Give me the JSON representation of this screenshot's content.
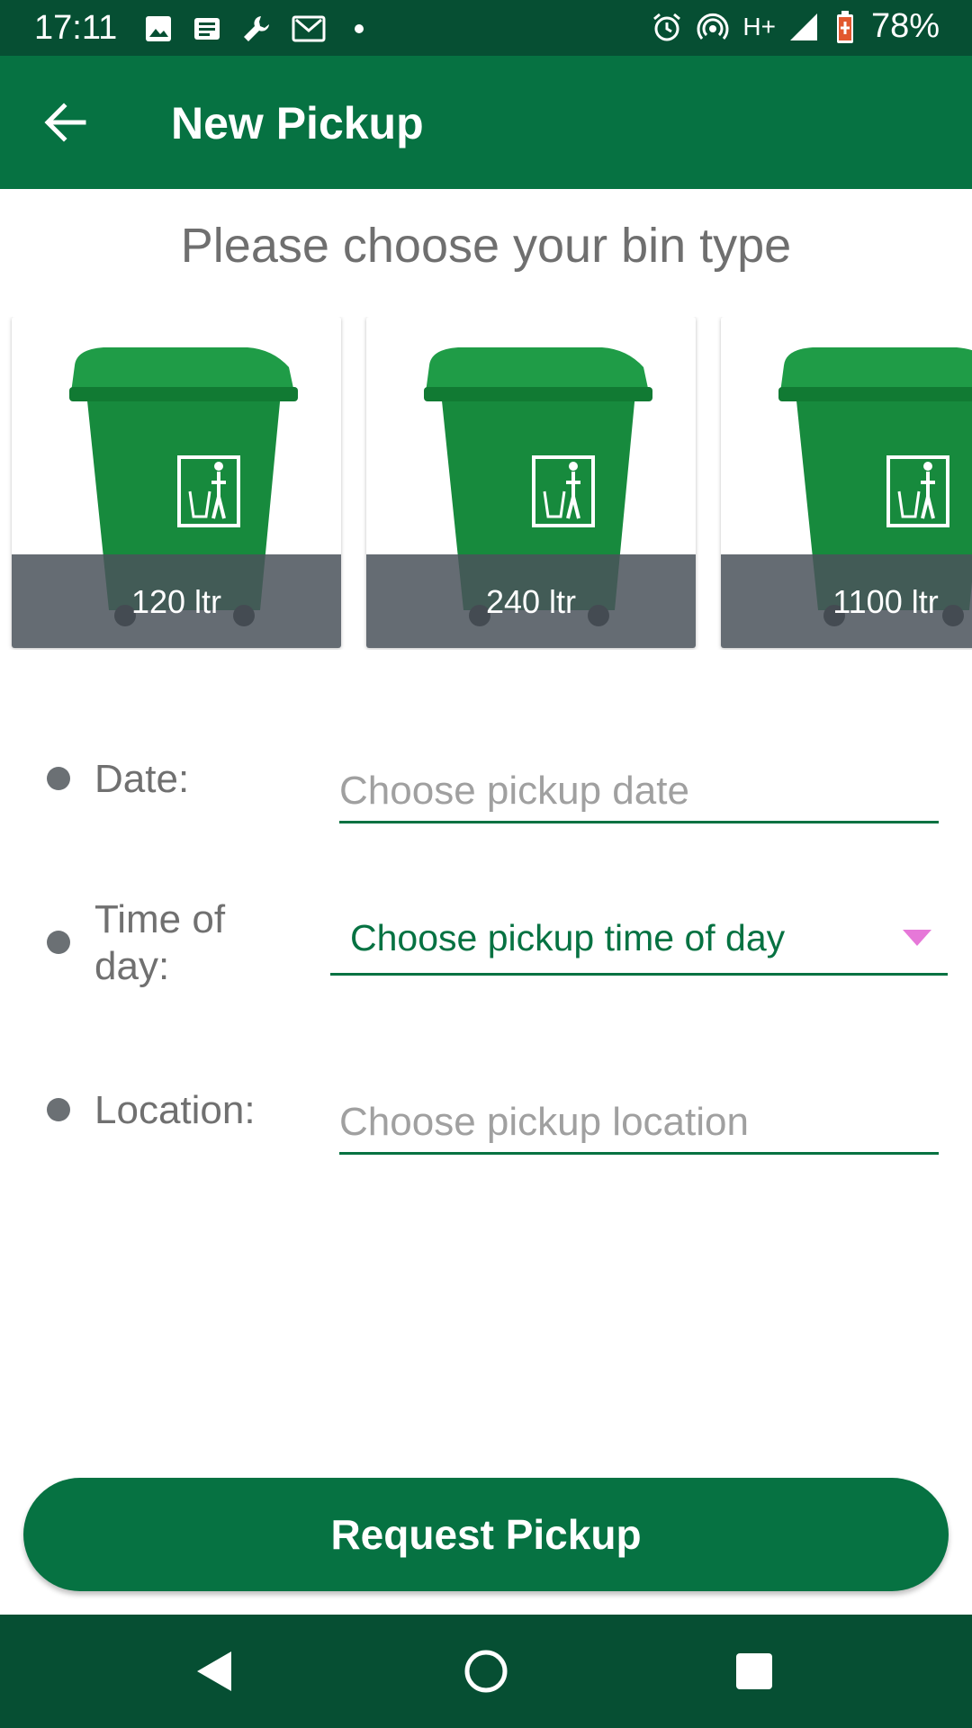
{
  "status_bar": {
    "time": "17:11",
    "battery": "78%",
    "network": "H+",
    "icons_left": [
      "image-icon",
      "news-icon",
      "wrench-icon",
      "gmail-icon",
      "dot-icon"
    ],
    "icons_right": [
      "alarm-icon",
      "hotspot-icon",
      "network-type",
      "signal-icon",
      "battery-icon"
    ]
  },
  "app_bar": {
    "title": "New Pickup",
    "back_icon": "arrow-left-icon"
  },
  "heading": "Please choose your bin type",
  "bins": [
    {
      "label": "120 ltr",
      "icon": "green-wheelie-bin"
    },
    {
      "label": "240 ltr",
      "icon": "green-wheelie-bin"
    },
    {
      "label": "1100 ltr",
      "icon": "green-wheelie-bin"
    }
  ],
  "form": {
    "date": {
      "label": "Date:",
      "placeholder": "Choose pickup date"
    },
    "time_of_day": {
      "label_line1": "Time of",
      "label_line2": "day:",
      "value": "Choose pickup time of day"
    },
    "location": {
      "label": "Location:",
      "placeholder": "Choose pickup location"
    }
  },
  "request_button": "Request Pickup",
  "colors": {
    "primary": "#067242",
    "status_bar": "#064f33",
    "caption_overlay": "#4a525a",
    "dropdown_arrow": "#e678d8"
  },
  "nav_bar": {
    "icons": [
      "back-triangle-icon",
      "home-circle-icon",
      "recents-square-icon"
    ]
  }
}
